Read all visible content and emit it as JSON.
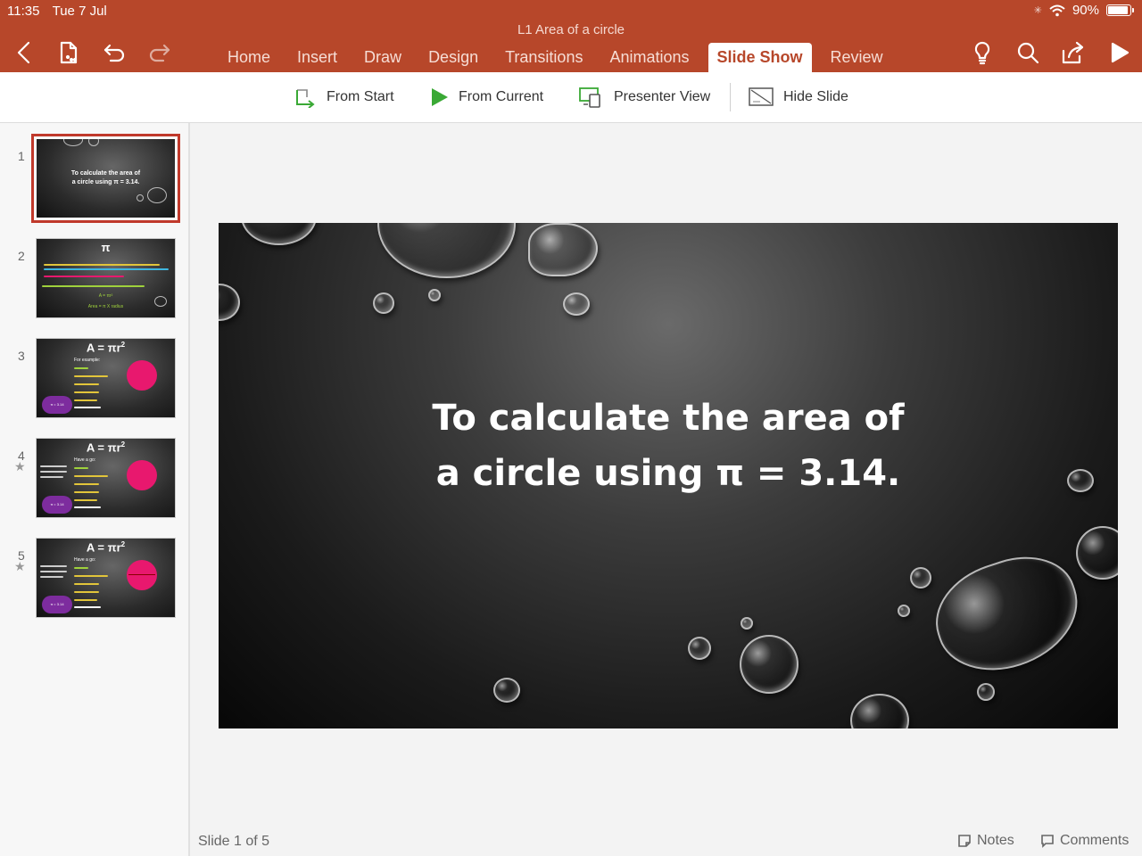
{
  "status_bar": {
    "time": "11:35",
    "date": "Tue 7 Jul",
    "battery": "90%",
    "battery_level": 0.9
  },
  "document": {
    "title": "L1 Area of a circle"
  },
  "toolbar": {
    "icons": [
      "back-icon",
      "file-icon",
      "undo-icon",
      "redo-icon",
      "lightbulb-icon",
      "search-icon",
      "share-icon",
      "play-icon"
    ]
  },
  "tabs": [
    {
      "label": "Home",
      "active": false
    },
    {
      "label": "Insert",
      "active": false
    },
    {
      "label": "Draw",
      "active": false
    },
    {
      "label": "Design",
      "active": false
    },
    {
      "label": "Transitions",
      "active": false
    },
    {
      "label": "Animations",
      "active": false
    },
    {
      "label": "Slide Show",
      "active": true
    },
    {
      "label": "Review",
      "active": false
    }
  ],
  "ribbon": {
    "from_start": "From Start",
    "from_current": "From Current",
    "presenter_view": "Presenter View",
    "hide_slide": "Hide Slide"
  },
  "thumbnails": [
    {
      "number": "1",
      "title_line1": "To calculate the area of",
      "title_line2": "a circle using π = 3.14.",
      "selected": true,
      "starred": false
    },
    {
      "number": "2",
      "heading": "π",
      "formula1": "A = πr²",
      "formula2": "Area = π X radius",
      "selected": false,
      "starred": false
    },
    {
      "number": "3",
      "heading": "A = πr",
      "heading_sup": "2",
      "subheading": "For example:",
      "badge": "π = 3.14",
      "selected": false,
      "starred": false
    },
    {
      "number": "4",
      "heading": "A = πr",
      "heading_sup": "2",
      "subheading": "Have a go:",
      "badge": "π = 3.14",
      "selected": false,
      "starred": true
    },
    {
      "number": "5",
      "heading": "A = πr",
      "heading_sup": "2",
      "subheading": "Have a go:",
      "badge": "π = 3.14",
      "selected": false,
      "starred": true
    }
  ],
  "slide": {
    "title_line1": "To calculate the area of",
    "title_line2": "a circle using π = 3.14."
  },
  "footer": {
    "slide_counter": "Slide 1 of 5",
    "notes": "Notes",
    "comments": "Comments"
  },
  "colors": {
    "app_bar": "#b7472a",
    "selection": "#c0392b",
    "play_green": "#3aa935",
    "circle_pink": "#e8186e",
    "badge_purple": "#7d2c9e"
  }
}
